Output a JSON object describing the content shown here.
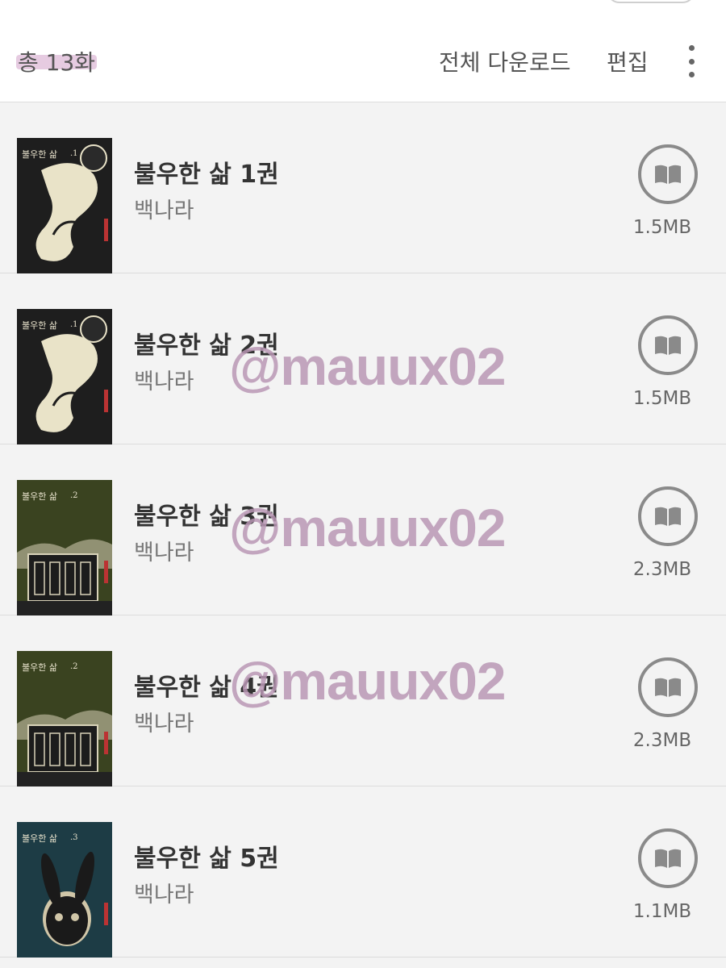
{
  "header": {
    "total": "총 13화",
    "download_all": "전체 다운로드",
    "edit": "편집",
    "more_icon": "more-vertical-icon"
  },
  "items": [
    {
      "title": "불우한 삶 1권",
      "author": "백나라",
      "size": "1.5MB",
      "cover_bg": "#1e1e1e",
      "cover_accent": "#e9e3c8",
      "cover_style": "figure"
    },
    {
      "title": "불우한 삶 2권",
      "author": "백나라",
      "size": "1.5MB",
      "cover_bg": "#1e1e1e",
      "cover_accent": "#e9e3c8",
      "cover_style": "figure"
    },
    {
      "title": "불우한 삶 3권",
      "author": "백나라",
      "size": "2.3MB",
      "cover_bg": "#3a4320",
      "cover_accent": "#d8d2b8",
      "cover_style": "building"
    },
    {
      "title": "불우한 삶 4권",
      "author": "백나라",
      "size": "2.3MB",
      "cover_bg": "#3a4320",
      "cover_accent": "#d8d2b8",
      "cover_style": "building"
    },
    {
      "title": "불우한 삶 5권",
      "author": "백나라",
      "size": "1.1MB",
      "cover_bg": "#1d3c45",
      "cover_accent": "#d0c6a8",
      "cover_style": "rabbit"
    }
  ],
  "cover_title": "불우한 삶",
  "cover_volume_marks": [
    ".1",
    ".1",
    ".2",
    ".2",
    ".3"
  ],
  "read_icon": "open-book-icon",
  "watermark": "@mauux02"
}
